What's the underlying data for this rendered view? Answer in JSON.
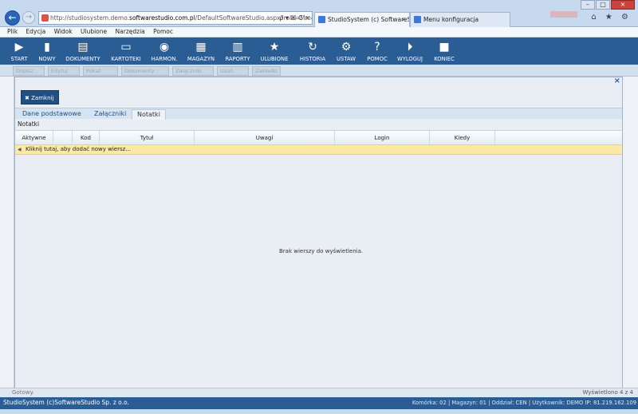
{
  "browser": {
    "url_prefix": "http://studiosystem.demo.",
    "url_domain": "softwarestudio.com.pl",
    "url_suffix": "/DefaultSoftwareStudio.aspx?rola=Mm&n",
    "addr_tools": "ρ ▾ ☒ C ×",
    "tabs": [
      {
        "label": "StudioSystem (c) SoftwareS..."
      },
      {
        "label": "Menu konfiguracja"
      }
    ],
    "tab_close": "×",
    "win_min": "–",
    "win_max": "□",
    "win_close": "×",
    "icons": "⌂ ★ ⚙"
  },
  "menubar": [
    "Plik",
    "Edycja",
    "Widok",
    "Ulubione",
    "Narzędzia",
    "Pomoc"
  ],
  "toolbar": [
    {
      "label": "START",
      "icon": "▶"
    },
    {
      "label": "NOWY",
      "icon": "▮"
    },
    {
      "label": "DOKUMENTY",
      "icon": "▤"
    },
    {
      "label": "KARTOTEKI",
      "icon": "▭"
    },
    {
      "label": "HARMON.",
      "icon": "◉"
    },
    {
      "label": "MAGAZYN",
      "icon": "▦"
    },
    {
      "label": "RAPORTY",
      "icon": "▥"
    },
    {
      "label": "ULUBIONE",
      "icon": "★"
    },
    {
      "label": "HISTORIA",
      "icon": "↻"
    },
    {
      "label": "USTAW",
      "icon": "⚙"
    },
    {
      "label": "POMOC",
      "icon": "?"
    },
    {
      "label": "WYLOGUJ",
      "icon": "⏵"
    },
    {
      "label": "KONIEC",
      "icon": "■"
    }
  ],
  "subtoolbar": [
    "Dopisz",
    "Edytuj",
    "Pokaż",
    "Dokumenty",
    "Załączniki",
    "Usuń",
    "Zakładki"
  ],
  "modal": {
    "close_x": "×",
    "close_button": "Zamknij",
    "close_icon": "✖",
    "tabs": [
      "Dane podstawowe",
      "Załączniki",
      "Notatki"
    ],
    "section": "Notatki",
    "columns": [
      "Aktywne",
      "",
      "Kod",
      "Tytuł",
      "Uwagi",
      "Login",
      "Kiedy",
      ""
    ],
    "add_row": "Kliknij tutaj, aby dodać nowy wiersz...",
    "empty": "Brak wierszy do wyświetlenia."
  },
  "status": {
    "left": "Gotowy.",
    "right": "Wyświetlono 4 z 4"
  },
  "footer": {
    "left": "StudioSystem (c)SoftwareStudio Sp. z o.o.",
    "right": "Komórka: 02 | Magazyn: 01 | Oddział: CEN | Użytkownik: DEMO IP: 81.219.162.109"
  }
}
